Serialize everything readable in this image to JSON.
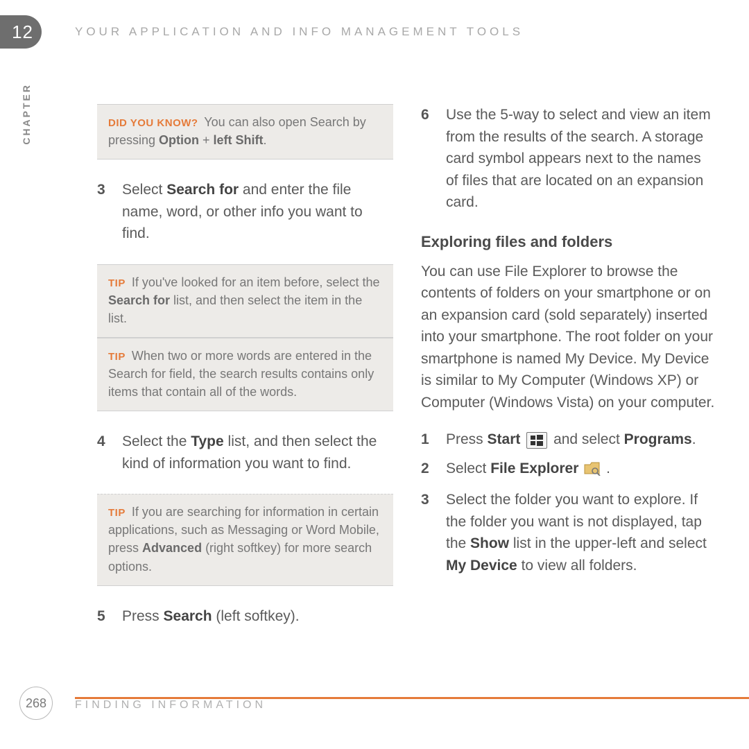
{
  "chapter": {
    "number": "12",
    "label": "CHAPTER"
  },
  "running_head": "YOUR APPLICATION AND INFO MANAGEMENT TOOLS",
  "footer": {
    "page": "268",
    "section": "FINDING INFORMATION"
  },
  "labels": {
    "did_you_know": "DID YOU KNOW?",
    "tip": "TIP"
  },
  "left": {
    "dyk": {
      "pre": " You can also open Search by pressing ",
      "k1": "Option",
      "plus": " + ",
      "k2": "left Shift",
      "post": "."
    },
    "step3": {
      "num": "3",
      "a": "Select ",
      "b": "Search for",
      "c": " and enter the file name, word, or other info you want to find."
    },
    "tip1": {
      "a": " If you've looked for an item before, select the ",
      "b": "Search for",
      "c": " list, and then select the item in the list."
    },
    "tip2": {
      "a": " When two or more words are entered in the Search for field, the search results contains only items that contain all of the words."
    },
    "step4": {
      "num": "4",
      "a": "Select the ",
      "b": "Type",
      "c": " list, and then select the kind of information you want to find."
    },
    "tip3": {
      "a": " If you are searching for information in certain applications, such as Messaging or Word Mobile, press ",
      "b": "Advanced",
      "c": " (right softkey) for more search options."
    },
    "step5": {
      "num": "5",
      "a": "Press ",
      "b": "Search",
      "c": " (left softkey)."
    }
  },
  "right": {
    "step6": {
      "num": "6",
      "a": "Use the 5-way to select and view an item from the results of the search. A storage card symbol appears next to the names of files that are located on an expansion card."
    },
    "heading": "Exploring files and folders",
    "intro": "You can use File Explorer to browse the contents of folders on your smartphone or on an expansion card (sold separately) inserted into your smartphone. The root folder on your smartphone is named My Device. My Device is similar to My Computer (Windows XP) or Computer (Windows Vista) on your computer.",
    "estep1": {
      "num": "1",
      "a": "Press ",
      "b": "Start",
      "c": " and select ",
      "d": "Programs",
      "e": "."
    },
    "estep2": {
      "num": "2",
      "a": "Select ",
      "b": "File Explorer",
      "c": " ."
    },
    "estep3": {
      "num": "3",
      "a": "Select the folder you want to explore. If the folder you want is not displayed, tap the ",
      "b": "Show",
      "c": " list in the upper-left and select ",
      "d": "My Device",
      "e": " to view all folders."
    }
  }
}
